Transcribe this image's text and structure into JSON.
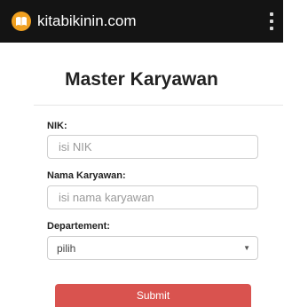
{
  "appbar": {
    "title": "kitabikinin.com",
    "logo_icon": "book-logo-icon",
    "menu_icon": "overflow-menu-icon",
    "background": "#141414",
    "logo_color": "#f0a020"
  },
  "page": {
    "title": "Master Karyawan"
  },
  "form": {
    "nik": {
      "label": "NIK:",
      "placeholder": "isi NIK",
      "value": ""
    },
    "nama": {
      "label": "Nama Karyawan:",
      "placeholder": "isi nama karyawan",
      "value": ""
    },
    "departement": {
      "label": "Departement:",
      "selected": "pilih",
      "caret_icon": "caret-down-icon"
    },
    "submit_label": "Submit",
    "submit_color": "#d9534f"
  }
}
